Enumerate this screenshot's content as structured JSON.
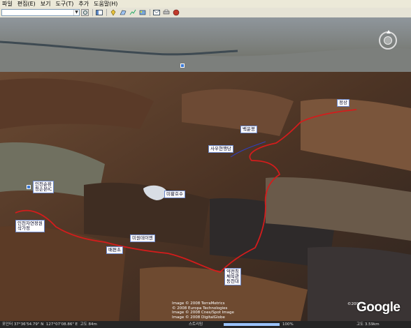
{
  "menu": {
    "items": [
      "파일",
      "편집(E)",
      "보기",
      "도구(T)",
      "추가",
      "도움말(H)"
    ]
  },
  "toolbar": {
    "search_placeholder": "",
    "buttons": [
      "sidebar-icon",
      "placemark-icon",
      "polygon-icon",
      "path-icon",
      "overlay-icon",
      "email-icon",
      "print-icon",
      "view-in-maps-icon"
    ]
  },
  "map": {
    "labels": {
      "jeongsang": "정상",
      "baegun": "백운봉",
      "sumum": "사우현행당",
      "hwangmul": "미황호수",
      "gyeongin": "인천순환\n청손본IC",
      "seonggye": "인천자연정원\n삭가정",
      "wolgye": "미원데이엔",
      "baemin": "배편초",
      "seobu": "약전칭\n체육관\n동천대"
    },
    "route_color": "#d41c1c"
  },
  "overlay": {
    "copyright_lines": [
      "Image © 2008 TerraMetrics",
      "© 2008 Europa Technologies",
      "Image © 2008 Cnes/Spot Image",
      "Image © 2008 DigitalGlobe"
    ],
    "logo_text": "Google",
    "logo_year": "©2007"
  },
  "status": {
    "coords": "포인터 37°36'54.79\" N  127°07'08.86\" E  고도 84m",
    "streaming": "스트리밍",
    "streaming_percent": 100,
    "streaming_label": "100%",
    "eye_alt": "고도 3.59km"
  }
}
